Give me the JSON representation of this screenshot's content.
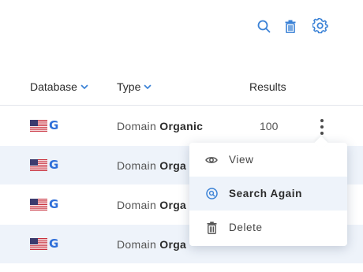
{
  "toolbar": {
    "icons": [
      "search-icon",
      "trash-icon",
      "gear-icon"
    ],
    "accent": "#3b82d6"
  },
  "table": {
    "headers": {
      "database": "Database",
      "type": "Type",
      "results": "Results"
    },
    "rows": [
      {
        "flag": "us-flag-icon",
        "engine": "G",
        "type_prefix": "Domain",
        "type_bold": "Organic",
        "results": "100"
      },
      {
        "flag": "us-flag-icon",
        "engine": "G",
        "type_prefix": "Domain",
        "type_bold": "Orga",
        "results": ""
      },
      {
        "flag": "us-flag-icon",
        "engine": "G",
        "type_prefix": "Domain",
        "type_bold": "Orga",
        "results": ""
      },
      {
        "flag": "us-flag-icon",
        "engine": "G",
        "type_prefix": "Domain",
        "type_bold": "Orga",
        "results": ""
      }
    ],
    "row_alt_color": "#eef3fa"
  },
  "menu": {
    "items": [
      {
        "icon": "eye-icon",
        "label": "View"
      },
      {
        "icon": "search-again-icon",
        "label": "Search Again"
      },
      {
        "icon": "trash-icon",
        "label": "Delete"
      }
    ]
  }
}
